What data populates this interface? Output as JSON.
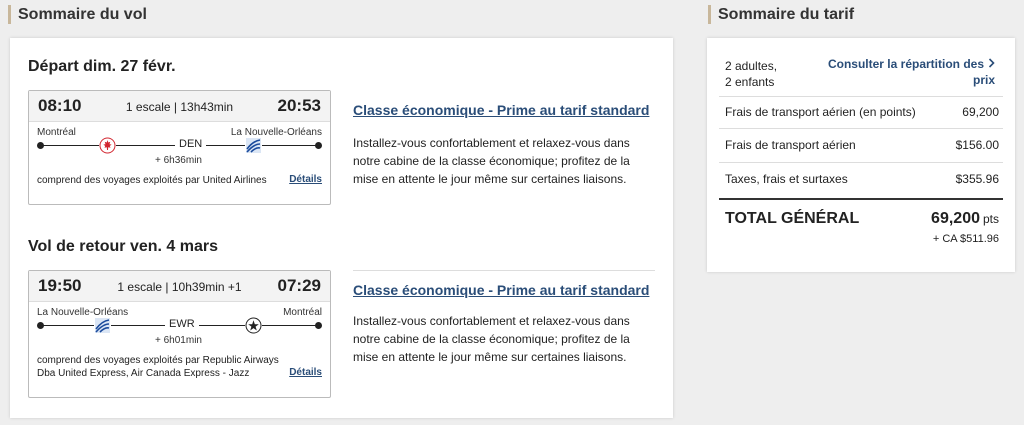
{
  "flight_summary": {
    "title": "Sommaire du vol",
    "outbound": {
      "heading": "Départ dim. 27 févr.",
      "dep_time": "08:10",
      "arr_time": "20:53",
      "stops_duration": "1 escale | 13h43min",
      "origin": "Montréal",
      "destination": "La Nouvelle-Orléans",
      "stop_code": "DEN",
      "layover": "+ 6h36min",
      "operated_by": "comprend des voyages exploités par United Airlines",
      "details_label": "Détails",
      "cabin_link": "Classe économique - Prime au tarif standard",
      "cabin_desc": "Installez-vous confortablement et relaxez-vous dans notre cabine de la classe économique; profitez de la mise en attente le jour même sur certaines liaisons."
    },
    "return": {
      "heading": "Vol de retour ven. 4 mars",
      "dep_time": "19:50",
      "arr_time": "07:29",
      "stops_duration": "1 escale | 10h39min +1",
      "origin": "La Nouvelle-Orléans",
      "destination": "Montréal",
      "stop_code": "EWR",
      "layover": "+ 6h01min",
      "operated_by_line1": "comprend des voyages exploités par Republic Airways",
      "operated_by_line2": "Dba United Express, Air Canada Express - Jazz",
      "details_label": "Détails",
      "cabin_link": "Classe économique - Prime au tarif standard",
      "cabin_desc": "Installez-vous confortablement et relaxez-vous dans notre cabine de la classe économique; profitez de la mise en attente le jour même sur certaines liaisons."
    }
  },
  "fare_summary": {
    "title": "Sommaire du tarif",
    "passengers_line1": "2 adultes,",
    "passengers_line2": "2 enfants",
    "breakdown_line1": "Consulter la répartition des",
    "breakdown_line2": "prix",
    "rows": [
      {
        "label": "Frais de transport aérien (en points)",
        "value": "69,200"
      },
      {
        "label": "Frais de transport aérien",
        "value": "$156.00"
      },
      {
        "label": "Taxes, frais et surtaxes",
        "value": "$355.96"
      }
    ],
    "total_label": "TOTAL GÉNÉRAL",
    "total_points": "69,200",
    "total_unit": "pts",
    "total_cash": "+ CA $511.96"
  },
  "icons": {
    "outbound_origin_airline": "air-canada-maple-leaf-icon",
    "outbound_dest_airline": "united-airlines-globe-icon",
    "return_origin_airline": "united-airlines-globe-icon",
    "return_dest_airline": "star-alliance-icon",
    "chevron": "chevron-right-icon"
  },
  "colors": {
    "link": "#2a4d78",
    "accent_bar": "#c8b79b",
    "air_canada_red": "#d22630",
    "united_blue": "#1a4a9c"
  }
}
